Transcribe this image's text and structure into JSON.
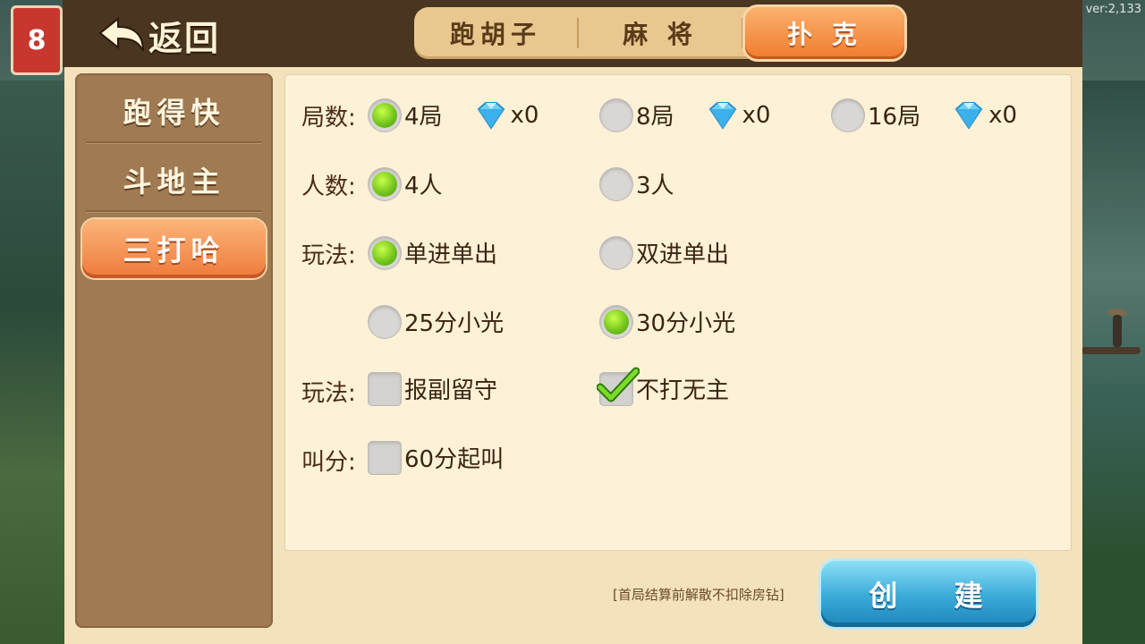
{
  "version": "ver:2,133",
  "logo": {
    "text": "8"
  },
  "header": {
    "back_label": "返回",
    "tabs": [
      {
        "label": "跑胡子",
        "active": false
      },
      {
        "label": "麻 将",
        "active": false
      },
      {
        "label": "扑 克",
        "active": true
      }
    ]
  },
  "sidebar": {
    "items": [
      {
        "label": "跑得快",
        "active": false
      },
      {
        "label": "斗地主",
        "active": false
      },
      {
        "label": "三打哈",
        "active": true
      }
    ]
  },
  "options": {
    "rounds": {
      "label": "局数:",
      "choices": [
        {
          "label": "4局",
          "selected": true,
          "cost": "x0"
        },
        {
          "label": "8局",
          "selected": false,
          "cost": "x0"
        },
        {
          "label": "16局",
          "selected": false,
          "cost": "x0"
        }
      ]
    },
    "players": {
      "label": "人数:",
      "choices": [
        {
          "label": "4人",
          "selected": true
        },
        {
          "label": "3人",
          "selected": false
        }
      ]
    },
    "play_mode": {
      "label": "玩法:",
      "choices": [
        {
          "label": "单进单出",
          "selected": true
        },
        {
          "label": "双进单出",
          "selected": false
        },
        {
          "label": "25分小光",
          "selected": false
        },
        {
          "label": "30分小光",
          "selected": true
        }
      ]
    },
    "play_rules": {
      "label": "玩法:",
      "choices": [
        {
          "label": "报副留守",
          "checked": false
        },
        {
          "label": "不打无主",
          "checked": true
        }
      ]
    },
    "bidding": {
      "label": "叫分:",
      "choices": [
        {
          "label": "60分起叫",
          "checked": false
        }
      ]
    }
  },
  "notice": "[首局结算前解散不扣除房钻]",
  "create_label": "创 建",
  "colors": {
    "accent_orange": "#f07b2d",
    "radio_selected": "#6fc21a",
    "create_blue": "#38a9d8",
    "header_brown": "#4a3520"
  }
}
